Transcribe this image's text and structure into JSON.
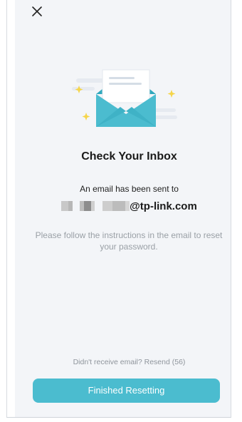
{
  "header": {
    "close_icon": "close-icon"
  },
  "illustration": {
    "icon": "open-envelope-illustration",
    "colors": {
      "envelope": "#4bbccf",
      "envelope_dark": "#2fa8bd",
      "letter": "#ffffff",
      "sparkle": "#f5d54a"
    }
  },
  "content": {
    "title": "Check Your Inbox",
    "sent_text": "An email has been sent to",
    "email_domain": "@tp-link.com",
    "hint": "Please follow the instructions in the email to reset your password."
  },
  "footer": {
    "resend_text": "Didn't receive email? Resend (56)",
    "finished_label": "Finished Resetting"
  },
  "colors": {
    "accent": "#4bbccf",
    "screen_bg": "#f3f5f8"
  }
}
